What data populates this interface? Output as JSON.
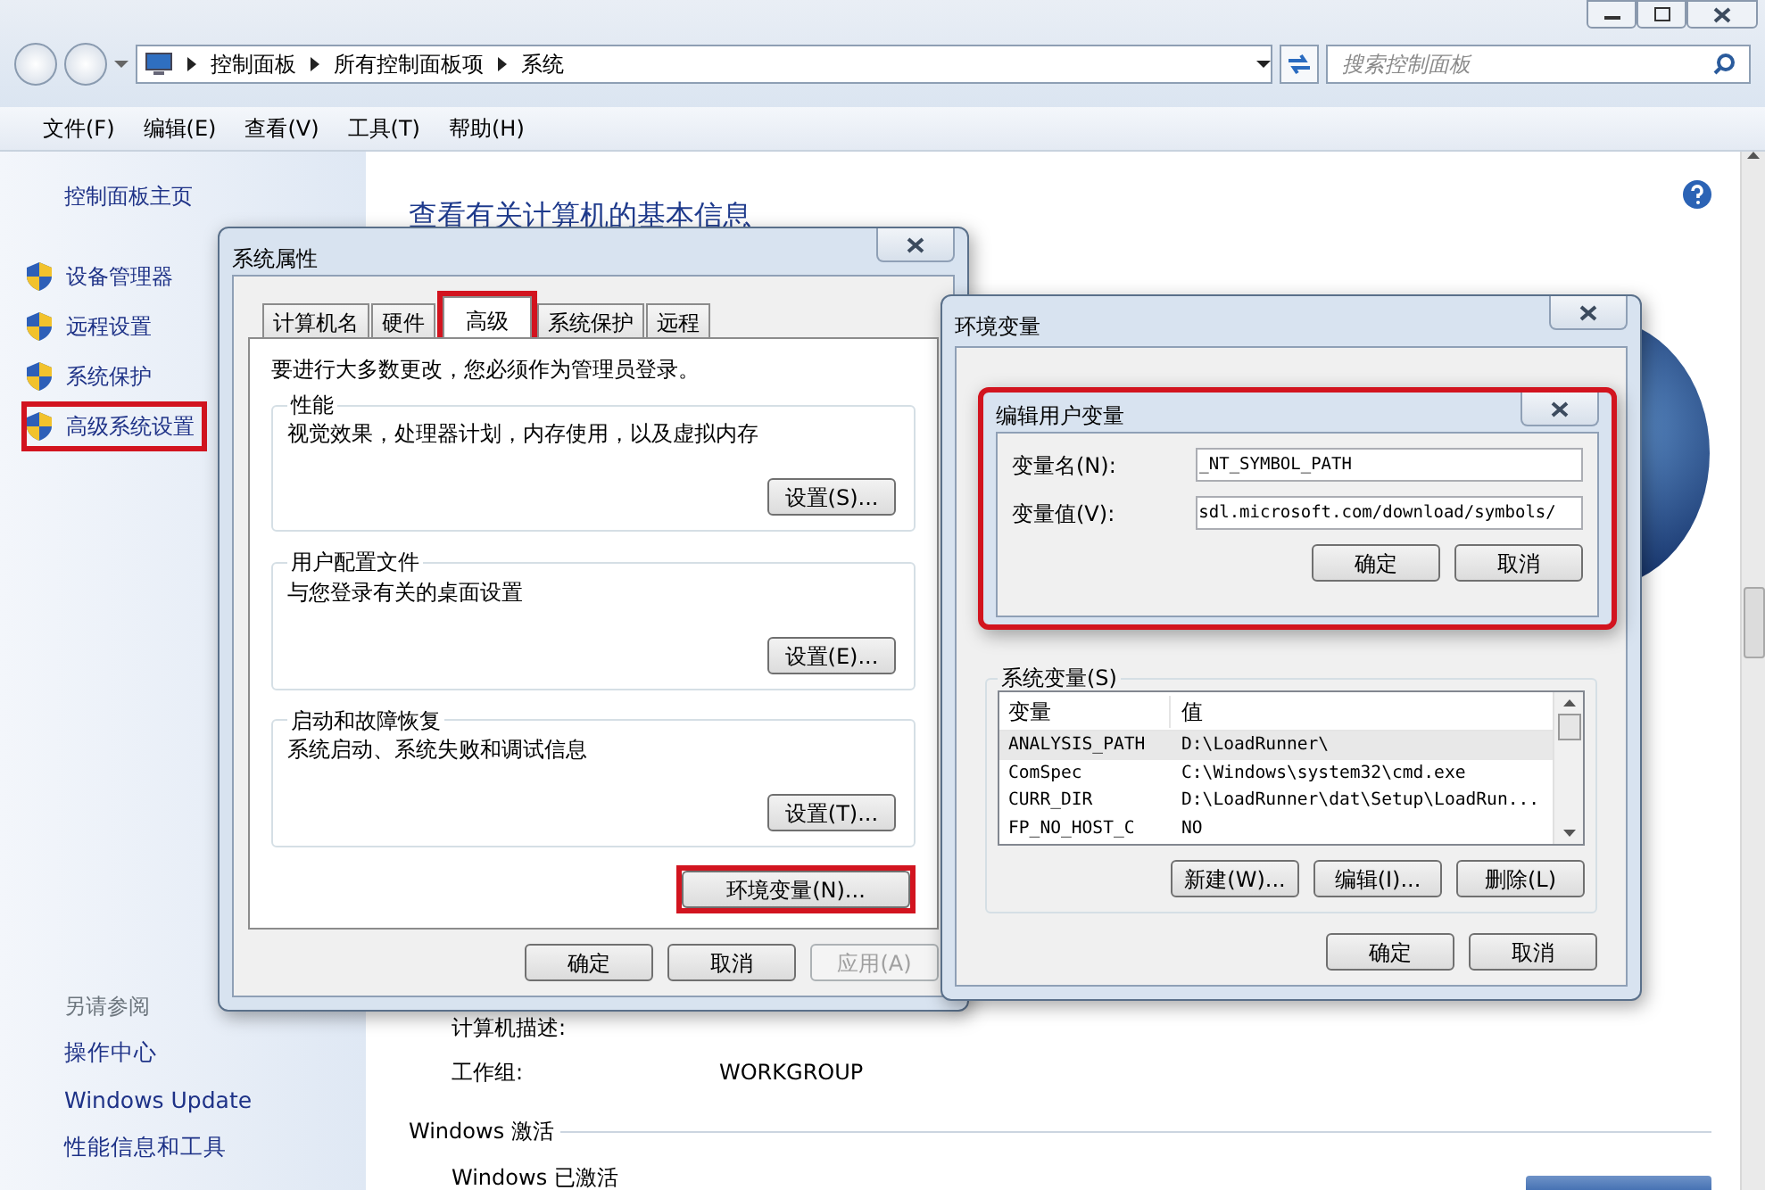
{
  "address_bar": {
    "breadcrumbs": [
      "控制面板",
      "所有控制面板项",
      "系统"
    ]
  },
  "search": {
    "placeholder": "搜索控制面板"
  },
  "menu": [
    "文件(F)",
    "编辑(E)",
    "查看(V)",
    "工具(T)",
    "帮助(H)"
  ],
  "sidebar": {
    "home": "控制面板主页",
    "items": [
      {
        "label": "设备管理器",
        "highlighted": false
      },
      {
        "label": "远程设置",
        "highlighted": false
      },
      {
        "label": "系统保护",
        "highlighted": false
      },
      {
        "label": "高级系统设置",
        "highlighted": true
      }
    ],
    "see_also": {
      "title": "另请参阅",
      "links": [
        "操作中心",
        "Windows Update",
        "性能信息和工具"
      ]
    }
  },
  "main": {
    "title": "查看有关计算机的基本信息",
    "fields": [
      {
        "label": "计算机描述:"
      },
      {
        "label": "工作组:",
        "value": "WORKGROUP"
      }
    ],
    "activation": {
      "heading": "Windows 激活",
      "status": "Windows 已激活"
    }
  },
  "system_properties": {
    "title": "系统属性",
    "tabs": [
      {
        "label": "计算机名",
        "selected": false,
        "highlighted": false
      },
      {
        "label": "硬件",
        "selected": false,
        "highlighted": false
      },
      {
        "label": "高级",
        "selected": true,
        "highlighted": true
      },
      {
        "label": "系统保护",
        "selected": false,
        "highlighted": false
      },
      {
        "label": "远程",
        "selected": false,
        "highlighted": false
      }
    ],
    "notice": "要进行大多数更改，您必须作为管理员登录。",
    "groups": [
      {
        "title": "性能",
        "description": "视觉效果，处理器计划，内存使用，以及虚拟内存",
        "button": "设置(S)..."
      },
      {
        "title": "用户配置文件",
        "description": "与您登录有关的桌面设置",
        "button": "设置(E)..."
      },
      {
        "title": "启动和故障恢复",
        "description": "系统启动、系统失败和调试信息",
        "button": "设置(T)..."
      }
    ],
    "env_button": {
      "label": "环境变量(N)...",
      "highlighted": true
    },
    "buttons": [
      {
        "label": "确定",
        "disabled": false
      },
      {
        "label": "取消",
        "disabled": false
      },
      {
        "label": "应用(A)",
        "disabled": true
      }
    ]
  },
  "environment_variables": {
    "title": "环境变量",
    "system_vars": {
      "title": "系统变量(S)",
      "columns": [
        "变量",
        "值"
      ],
      "rows": [
        {
          "name": "ANALYSIS_PATH",
          "value": "D:\\LoadRunner\\",
          "selected": true
        },
        {
          "name": "ComSpec",
          "value": "C:\\Windows\\system32\\cmd.exe",
          "selected": false
        },
        {
          "name": "CURR_DIR",
          "value": "D:\\LoadRunner\\dat\\Setup\\LoadRun...",
          "selected": false
        },
        {
          "name": "FP_NO_HOST_C",
          "value": "NO",
          "selected": false
        }
      ],
      "buttons": [
        "新建(W)...",
        "编辑(I)...",
        "删除(L)"
      ]
    },
    "buttons": [
      "确定",
      "取消"
    ]
  },
  "edit_user_variable": {
    "title": "编辑用户变量",
    "highlighted": true,
    "fields": [
      {
        "label": "变量名(N):",
        "value": "_NT_SYMBOL_PATH"
      },
      {
        "label": "变量值(V):",
        "value": "sdl.microsoft.com/download/symbols/"
      }
    ],
    "buttons": [
      "确定",
      "取消"
    ]
  }
}
